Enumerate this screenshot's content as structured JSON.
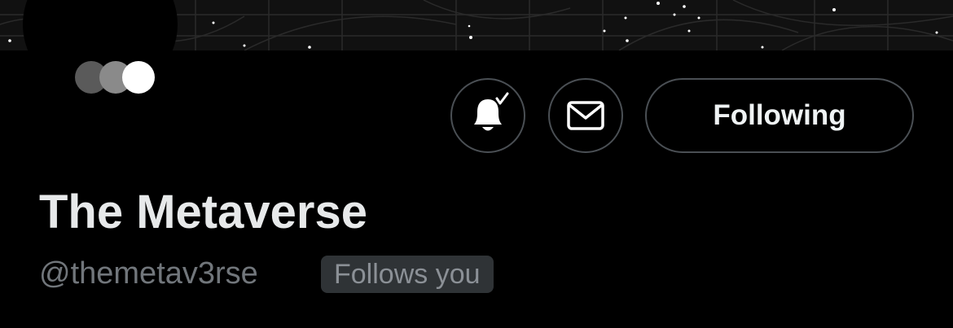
{
  "profile": {
    "display_name": "The Metaverse",
    "handle": "@themetav3rse",
    "follows_you_badge": "Follows you"
  },
  "actions": {
    "following_label": "Following",
    "notifications_icon": "bell-with-check-icon",
    "message_icon": "envelope-icon"
  },
  "logo": {
    "dot_colors": [
      "#5a5a5a",
      "#8a8a8a",
      "#ffffff"
    ]
  },
  "colors": {
    "background": "#000000",
    "button_border": "#4a4f54",
    "text_primary": "#e7e9ea",
    "text_secondary": "#71767b",
    "badge_background": "#2f3336"
  }
}
